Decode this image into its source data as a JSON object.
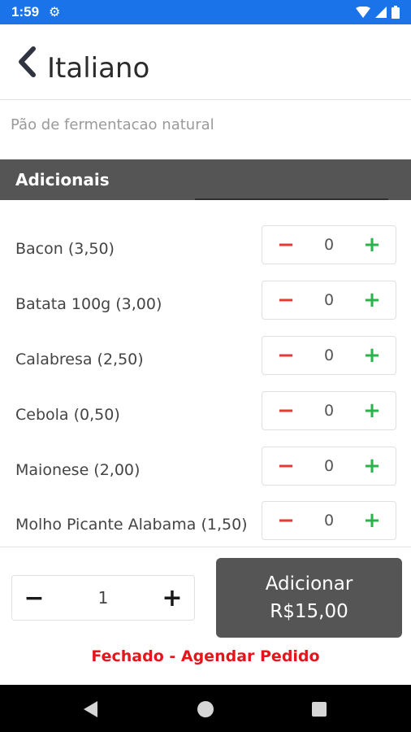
{
  "status_bar": {
    "time": "1:59"
  },
  "header": {
    "title": "Italiano"
  },
  "product": {
    "description": "Pão de fermentacao natural"
  },
  "section": {
    "title": "Adicionais"
  },
  "addons": [
    {
      "label": "Bacon (3,50)",
      "qty": "0"
    },
    {
      "label": "Batata 100g (3,00)",
      "qty": "0"
    },
    {
      "label": "Calabresa (2,50)",
      "qty": "0"
    },
    {
      "label": "Cebola (0,50)",
      "qty": "0"
    },
    {
      "label": "Maionese (2,00)",
      "qty": "0"
    },
    {
      "label": "Molho Picante Alabama (1,50)",
      "qty": "0"
    }
  ],
  "stepper_symbols": {
    "minus": "−",
    "plus": "+"
  },
  "order": {
    "quantity": "1"
  },
  "add_button": {
    "line1": "Adicionar",
    "line2": "R$15,00"
  },
  "closed_notice": "Fechado - Agendar Pedido",
  "colors": {
    "status_bar": "#1a73e8",
    "section_bar": "#555555",
    "minus": "#e53935",
    "plus": "#2bb24c",
    "notice": "#e3161b"
  }
}
